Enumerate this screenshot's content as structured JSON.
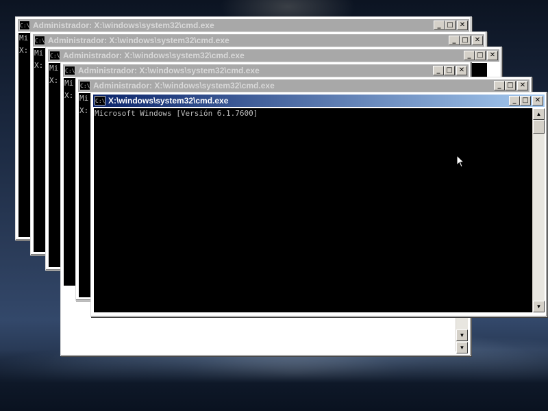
{
  "desktop": {
    "wallpaper": "dark night sky over mountain ridges"
  },
  "windows": [
    {
      "title": "Administrador: X:\\windows\\system32\\cmd.exe",
      "lines": [
        "Mi",
        "",
        "",
        "X:"
      ]
    },
    {
      "title": "Administrador: X:\\windows\\system32\\cmd.exe",
      "lines": [
        "Mi",
        "",
        "",
        "X:"
      ]
    },
    {
      "title": "Administrador: X:\\windows\\system32\\cmd.exe",
      "lines": [
        "Mi",
        "",
        "",
        "X:"
      ]
    },
    {
      "title": "Administrador: X:\\windows\\system32\\cmd.exe",
      "lines": [
        "Mi",
        "",
        "",
        "X:"
      ]
    },
    {
      "title": "Administrador: X:\\windows\\system32\\cmd.exe",
      "lines": [
        "Mi",
        "",
        "",
        "X:"
      ]
    },
    {
      "title": "X:\\windows\\system32\\cmd.exe",
      "lines": [
        "Microsoft Windows [Versión 6.1.7600]"
      ]
    }
  ],
  "window_buttons": {
    "minimize": "_",
    "maximize": "□",
    "close": "✕"
  },
  "app_icon_label": "C:\\",
  "colors": {
    "active_title": "#0a246a",
    "inactive_title": "#a8a8a8",
    "console_text": "#c0c0c0",
    "console_bg": "#000000"
  },
  "icons": [
    "cmd-app-icon",
    "minimize-icon",
    "maximize-icon",
    "close-icon",
    "scroll-up-icon",
    "scroll-down-icon",
    "mouse-pointer-icon"
  ]
}
